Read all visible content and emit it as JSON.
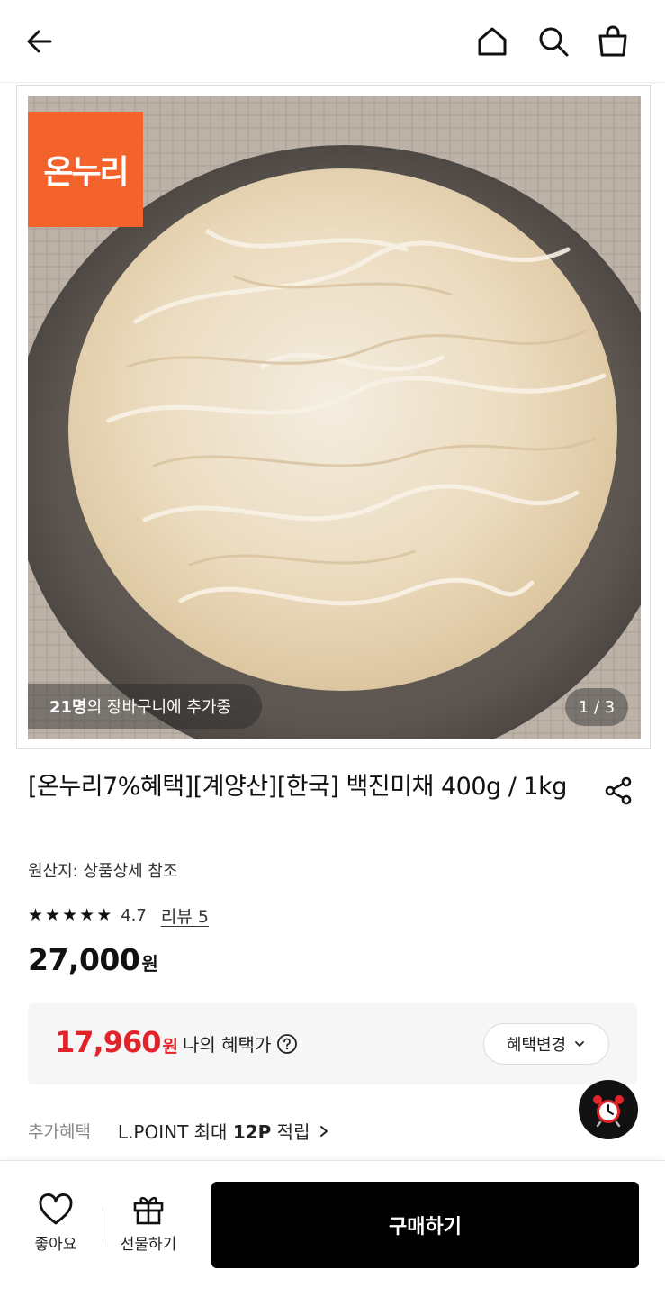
{
  "header": {
    "back_icon": "arrow-left-icon",
    "home_icon": "home-icon",
    "search_icon": "search-icon",
    "cart_icon": "shopping-bag-icon"
  },
  "gallery": {
    "brand_badge": "온누리",
    "cart_count": "21명",
    "cart_text": "의 장바구니에 추가중",
    "page_indicator": "1 / 3"
  },
  "product": {
    "title": "[온누리7%혜택][계양산][한국] 백진미채 400g / 1kg",
    "share_icon": "share-icon",
    "origin": "원산지: 상품상세 참조",
    "rating": "4.7",
    "stars_filled": 4.7,
    "review_link": "리뷰 5",
    "price": "27,000",
    "price_unit": "원"
  },
  "benefit": {
    "price": "17,960",
    "price_unit": "원",
    "label": "나의 혜택가",
    "change_button": "혜택변경",
    "accent_color": "#e2242a"
  },
  "extra_benefit": {
    "label": "추가혜택",
    "value_prefix": "L.POINT 최대 ",
    "value_bold": "12P",
    "value_suffix": " 적립"
  },
  "floating": {
    "alarm_icon": "alarm-clock-icon"
  },
  "bottom_bar": {
    "like_label": "좋아요",
    "gift_label": "선물하기",
    "buy_button": "구매하기"
  }
}
